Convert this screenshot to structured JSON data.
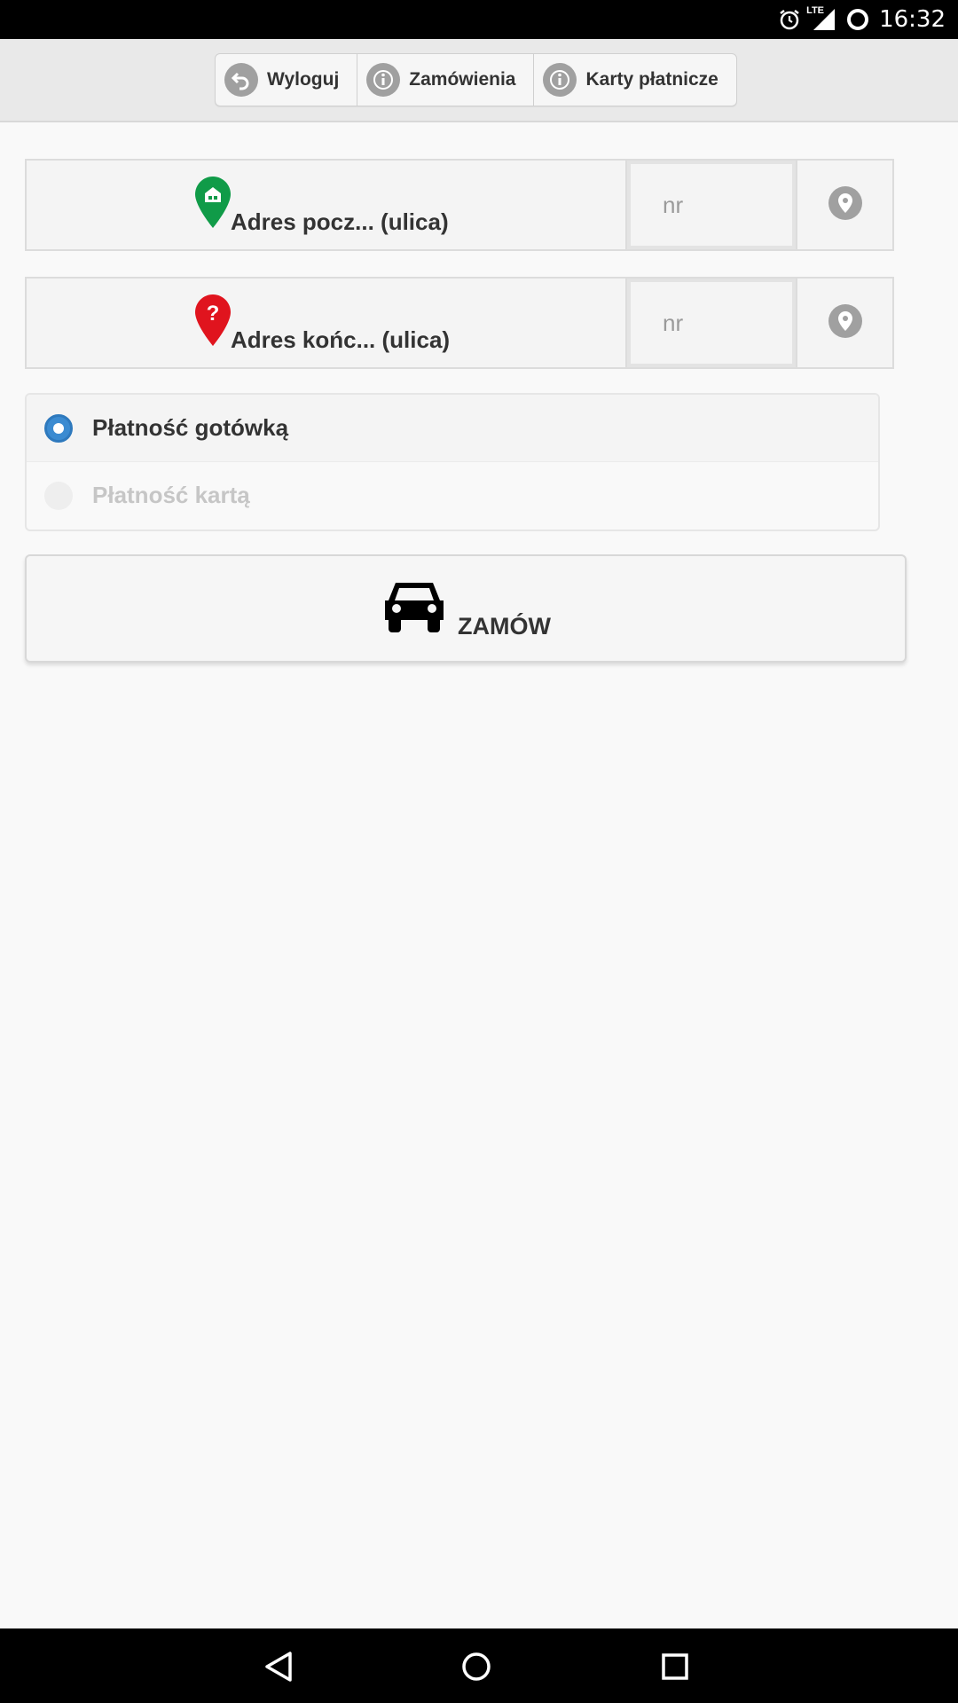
{
  "status_bar": {
    "time": "16:32",
    "network": "LTE",
    "icons": [
      "alarm-icon",
      "signal-icon",
      "battery-icon"
    ]
  },
  "toolbar": {
    "buttons": [
      {
        "label": "Wyloguj",
        "icon": "undo-icon"
      },
      {
        "label": "Zamówienia",
        "icon": "info-icon"
      },
      {
        "label": "Karty płatnicze",
        "icon": "info-icon"
      }
    ]
  },
  "pickup": {
    "label": "Adres pocz... (ulica)",
    "number_placeholder": "nr",
    "icon": "pickup-pin-icon",
    "icon_color": "#109b48"
  },
  "destination": {
    "label": "Adres końc... (ulica)",
    "number_placeholder": "nr",
    "icon": "destination-pin-icon",
    "icon_color": "#e0141e"
  },
  "payment": {
    "options": [
      {
        "label": "Płatność gotówką",
        "selected": true
      },
      {
        "label": "Płatność kartą",
        "selected": false,
        "disabled": true
      }
    ],
    "accent": "#3b8bd1"
  },
  "order": {
    "label": "ZAMÓW",
    "icon": "car-icon"
  },
  "nav": {
    "icons": [
      "back-icon",
      "home-icon",
      "recents-icon"
    ]
  }
}
